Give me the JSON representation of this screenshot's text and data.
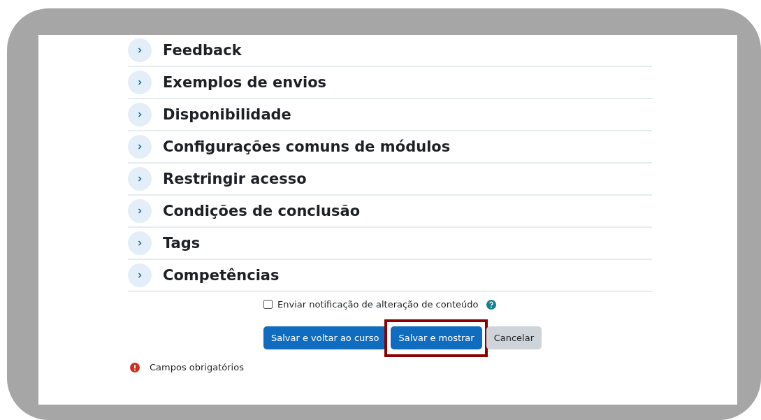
{
  "sections": [
    {
      "title": "Feedback",
      "expanded": false
    },
    {
      "title": "Exemplos de envios",
      "expanded": false
    },
    {
      "title": "Disponibilidade",
      "expanded": false
    },
    {
      "title": "Configurações comuns de módulos",
      "expanded": false
    },
    {
      "title": "Restringir acesso",
      "expanded": false
    },
    {
      "title": "Condições de conclusão",
      "expanded": false
    },
    {
      "title": "Tags",
      "expanded": false
    },
    {
      "title": "Competências",
      "expanded": false
    }
  ],
  "notify": {
    "label": "Enviar notificação de alteração de conteúdo",
    "checked": false
  },
  "buttons": [
    {
      "label": "Salvar e voltar ao curso",
      "kind": "primary",
      "highlighted": false
    },
    {
      "label": "Salvar e mostrar",
      "kind": "primary",
      "highlighted": true
    },
    {
      "label": "Cancelar",
      "kind": "secondary",
      "highlighted": false
    }
  ],
  "required_note": "Campos obrigatórios"
}
